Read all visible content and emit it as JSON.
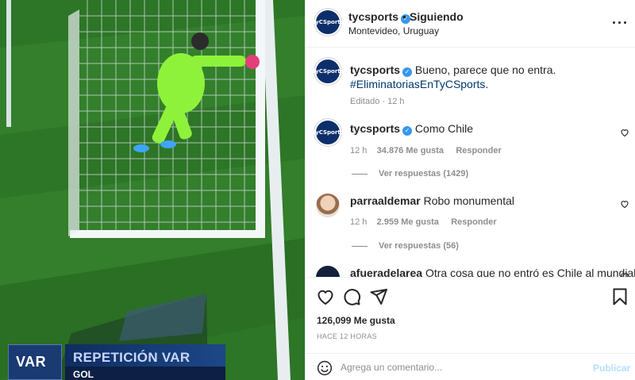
{
  "media": {
    "var_logo": "VAR",
    "var_title": "REPETICIÓN VAR",
    "var_subtitle": "GOL"
  },
  "header": {
    "username": "tycsports",
    "avatar_text": "TyCSports",
    "separator": "•",
    "follow_label": "Siguiendo",
    "location": "Montevideo, Uruguay"
  },
  "caption": {
    "username": "tycsports",
    "text": "Bueno, parece que no entra.",
    "hashtag": "#EliminatoriasEnTyCSports",
    "hashtag_suffix": ".",
    "meta": "Editado · 12 h"
  },
  "comments": [
    {
      "username": "tycsports",
      "text": "Como Chile",
      "time": "12 h",
      "likes": "34.876 Me gusta",
      "reply_label": "Responder",
      "view_replies": "Ver respuestas (1429)"
    },
    {
      "username": "parraaldemar",
      "text": "Robo monumental",
      "time": "12 h",
      "likes": "2.959 Me gusta",
      "reply_label": "Responder",
      "view_replies": "Ver respuestas (56)"
    },
    {
      "username": "afueradelarea",
      "text": "Otra cosa que no entró es Chile al mundial."
    }
  ],
  "stats": {
    "likes": "126,099 Me gusta",
    "time_ago": "HACE 12 HORAS"
  },
  "composer": {
    "placeholder": "Agrega un comentario...",
    "publish_label": "Publicar"
  },
  "icons": {
    "like": "heart-icon",
    "comment": "comment-icon",
    "share": "paper-plane-icon",
    "save": "bookmark-icon",
    "emoji": "emoji-icon",
    "more": "more-options-icon",
    "verified": "verified-badge-icon"
  },
  "colors": {
    "verified": "#3897f0",
    "hashtag": "#00376b",
    "publish_disabled": "#b2dffc",
    "pitch": "#2f7a2a",
    "keeper_kit": "#8ff23a",
    "var_blue": "#1a3a72"
  }
}
